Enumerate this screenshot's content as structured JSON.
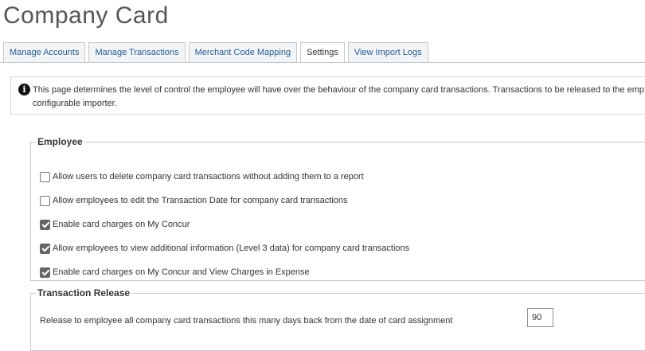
{
  "page": {
    "title": "Company Card"
  },
  "tabs": [
    {
      "label": "Manage Accounts"
    },
    {
      "label": "Manage Transactions"
    },
    {
      "label": "Merchant Code Mapping"
    },
    {
      "label": "Settings",
      "active": true
    },
    {
      "label": "View Import Logs"
    }
  ],
  "info": {
    "icon": "info-icon",
    "text": "This page determines the level of control the employee will have over the behaviour of the company card transactions. Transactions to be released to the emp",
    "text2": "configurable importer."
  },
  "employee": {
    "title": "Employee",
    "options": [
      {
        "label": "Allow users to delete company card transactions without adding them to a report",
        "checked": false
      },
      {
        "label": "Allow employees to edit the Transaction Date for company card transactions",
        "checked": false
      },
      {
        "label": "Enable card charges on My Concur",
        "checked": true
      },
      {
        "label": "Allow employees to view additional information (Level 3 data) for company card transactions",
        "checked": true
      },
      {
        "label": "Enable card charges on My Concur and View Charges in Expense",
        "checked": true
      }
    ]
  },
  "release": {
    "title": "Transaction Release",
    "label": "Release to employee all company card transactions this many days back from the date of card assignment",
    "days": "90"
  }
}
